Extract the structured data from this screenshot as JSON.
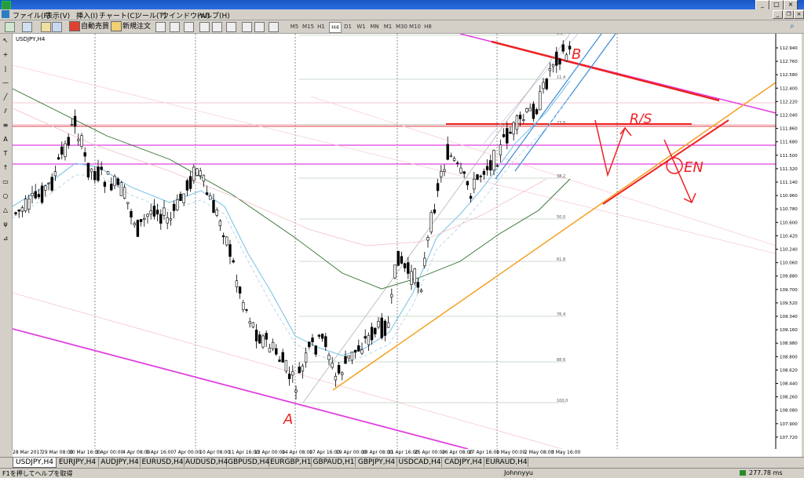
{
  "window": {
    "title": "USDJPY,H4]"
  },
  "menu": [
    "ファイル(F)",
    "表示(V)",
    "挿入(I)",
    "チャート(C)",
    "ツール(T)",
    "ウインドウ(W)",
    "ヘルプ(H)"
  ],
  "toolbar": {
    "auto_trade": "自動売買",
    "new_order": "新規注文"
  },
  "timeframes": [
    "M5",
    "M15",
    "H1",
    "H4",
    "D1",
    "W1",
    "MN",
    "M1",
    "M30",
    "M10",
    "H8"
  ],
  "active_timeframe": "H4",
  "chart": {
    "symbol": "USDJPY,H4",
    "price_labels": [
      "112.940",
      "112.760",
      "112.580",
      "112.400",
      "112.220",
      "112.040",
      "111.860",
      "111.680",
      "111.500",
      "111.320",
      "111.140",
      "110.960",
      "110.780",
      "110.600",
      "110.420",
      "110.240",
      "110.060",
      "109.880",
      "109.700",
      "109.520",
      "109.340",
      "109.160",
      "108.980",
      "108.800",
      "108.620",
      "108.440",
      "108.260",
      "108.080",
      "107.900",
      "107.720"
    ],
    "time_labels": [
      "28 Mar 2017",
      "29 Mar 08:00",
      "30 Mar 16:00",
      "3 Apr 00:00",
      "4 Apr 08:00",
      "5 Apr 16:00",
      "7 Apr 00:00",
      "10 Apr 08:00",
      "11 Apr 16:00",
      "13 Apr 00:00",
      "14 Apr 08:00",
      "17 Apr 16:00",
      "19 Apr 00:00",
      "20 Apr 08:00",
      "21 Apr 16:00",
      "25 Apr 00:00",
      "26 Apr 08:00",
      "27 Apr 16:00",
      "1 May 00:00",
      "2 May 08:00",
      "3 May 16:00"
    ],
    "fib_labels": [
      "0.0",
      "23.6",
      "38.2",
      "50.0",
      "61.8",
      "76.4",
      "88.6",
      "100.0",
      "11.4"
    ],
    "annotations": {
      "a": "A",
      "b": "B",
      "rs": "R/S",
      "en": "EN"
    }
  },
  "tabs": [
    "USDJPY,H4",
    "EURJPY,H4",
    "AUDJPY,H4",
    "EURUSD,H4",
    "AUDUSD,H4",
    "GBPUSD,H4",
    "EURGBP,H1",
    "GBPAUD,H1",
    "GBPJPY,H4",
    "USDCAD,H4",
    "CADJPY,H4",
    "EURAUD,H4"
  ],
  "active_tab": "USDJPY,H4",
  "status": {
    "help": "F1を押してヘルプを取得",
    "profile": "Johnnyyu",
    "speed": "277.78 ms"
  },
  "colors": {
    "magenta": "#e040e0",
    "red": "#ee2222",
    "orange": "#f5a020",
    "blue": "#3a8ad8",
    "lightblue": "#88c8e8",
    "green": "#2e6b2e",
    "pinkline": "#f0b8c8"
  }
}
